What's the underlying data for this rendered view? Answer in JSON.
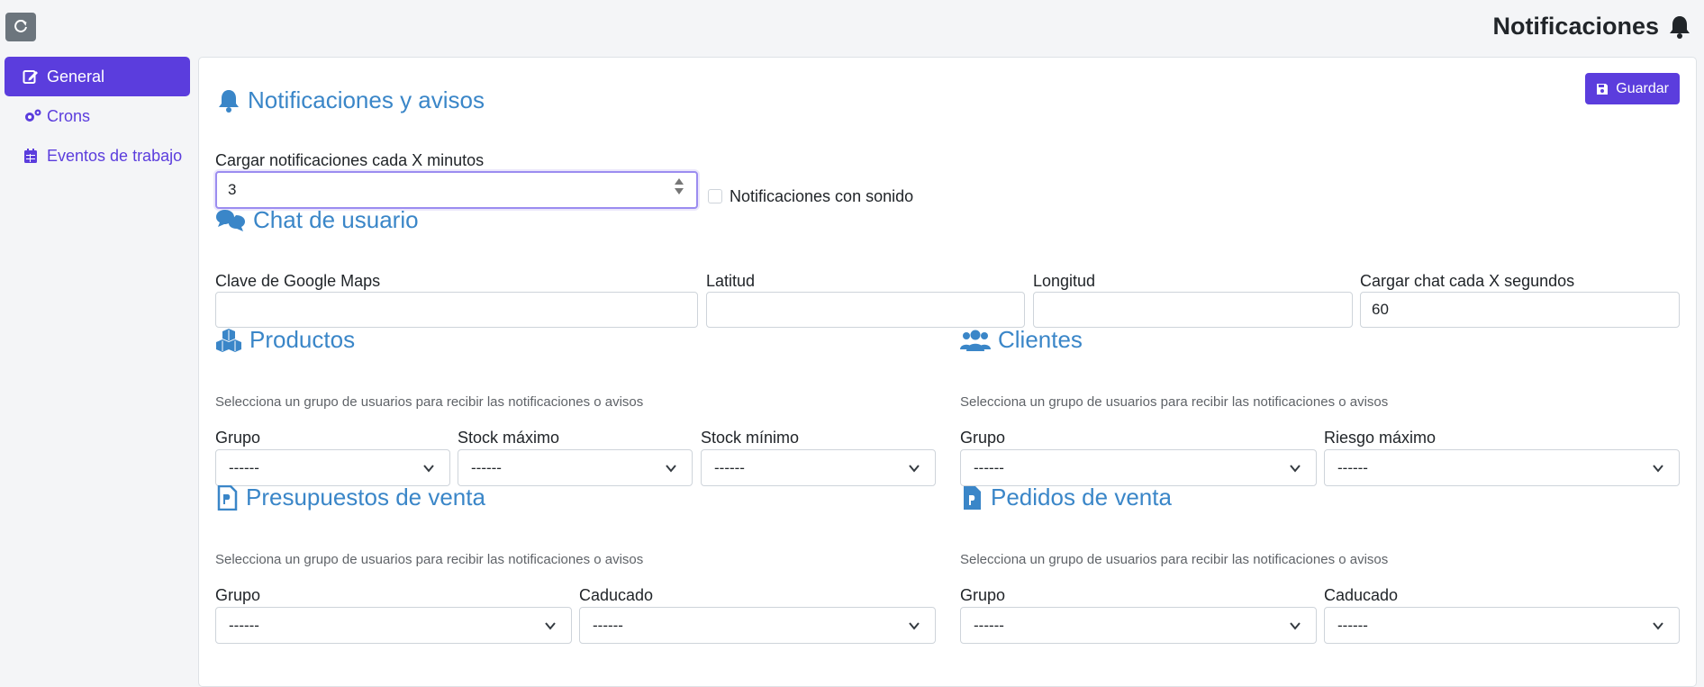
{
  "header": {
    "title": "Notificaciones"
  },
  "sidebar": {
    "items": [
      {
        "label": "General"
      },
      {
        "label": "Crons"
      },
      {
        "label": "Eventos de trabajo"
      }
    ]
  },
  "toolbar": {
    "save_label": "Guardar"
  },
  "notifications": {
    "title": "Notificaciones y avisos",
    "interval_label": "Cargar notificaciones cada X minutos",
    "interval_value": "3",
    "sound_label": "Notificaciones con sonido"
  },
  "chat": {
    "title": "Chat de usuario",
    "maps_key_label": "Clave de Google Maps",
    "maps_key_value": "",
    "latitude_label": "Latitud",
    "latitude_value": "",
    "longitude_label": "Longitud",
    "longitude_value": "",
    "refresh_label": "Cargar chat cada X segundos",
    "refresh_value": "60"
  },
  "products": {
    "title": "Productos",
    "help": "Selecciona un grupo de usuarios para recibir las notificaciones o avisos",
    "group_label": "Grupo",
    "group_value": "------",
    "max_label": "Stock máximo",
    "max_value": "------",
    "min_label": "Stock mínimo",
    "min_value": "------"
  },
  "clients": {
    "title": "Clientes",
    "help": "Selecciona un grupo de usuarios para recibir las notificaciones o avisos",
    "group_label": "Grupo",
    "group_value": "------",
    "risk_label": "Riesgo máximo",
    "risk_value": "------"
  },
  "quotes": {
    "title": "Presupuestos de venta",
    "help": "Selecciona un grupo de usuarios para recibir las notificaciones o avisos",
    "group_label": "Grupo",
    "group_value": "------",
    "expired_label": "Caducado",
    "expired_value": "------"
  },
  "orders": {
    "title": "Pedidos de venta",
    "help": "Selecciona un grupo de usuarios para recibir las notificaciones o avisos",
    "group_label": "Grupo",
    "group_value": "------",
    "expired_label": "Caducado",
    "expired_value": "------"
  },
  "colors": {
    "accent": "#5b3ddd",
    "heading": "#3a86c8",
    "reload": "#6c757d"
  }
}
